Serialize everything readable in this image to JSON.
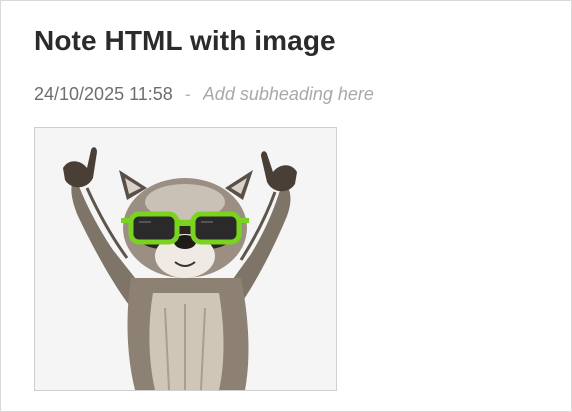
{
  "note": {
    "title": "Note HTML with image",
    "timestamp": "24/10/2025 11:58",
    "separator": "-",
    "subheading_placeholder": "Add subheading here",
    "subheading_value": ""
  },
  "image": {
    "subject": "raccoon with green sunglasses",
    "icon": "raccoon-image",
    "accent_color": "#7ad31f"
  }
}
